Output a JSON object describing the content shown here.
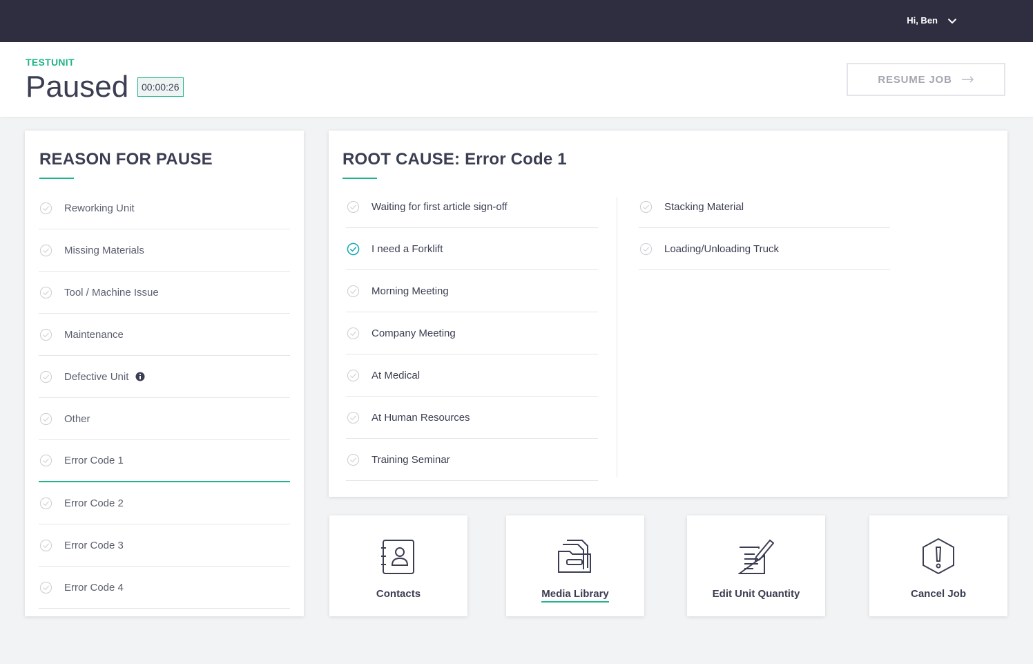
{
  "topbar": {
    "user_greeting": "Hi, Ben"
  },
  "header": {
    "unit_name": "TESTUNIT",
    "status": "Paused",
    "timer": "00:00:26",
    "resume_label": "RESUME JOB"
  },
  "reason_panel": {
    "title": "REASON FOR PAUSE",
    "items": [
      {
        "label": "Reworking Unit"
      },
      {
        "label": "Missing Materials"
      },
      {
        "label": "Tool / Machine Issue"
      },
      {
        "label": "Maintenance"
      },
      {
        "label": "Defective Unit"
      },
      {
        "label": "Other"
      },
      {
        "label": "Error Code 1"
      },
      {
        "label": "Error Code 2"
      },
      {
        "label": "Error Code 3"
      },
      {
        "label": "Error Code 4"
      }
    ],
    "selected": "Error Code 1"
  },
  "root_cause_panel": {
    "title": "ROOT CAUSE: Error Code 1",
    "column1": [
      {
        "label": "Waiting for first article sign-off"
      },
      {
        "label": "I need a Forklift"
      },
      {
        "label": "Morning Meeting"
      },
      {
        "label": "Company Meeting"
      },
      {
        "label": "At Medical"
      },
      {
        "label": "At Human Resources"
      },
      {
        "label": "Training Seminar"
      }
    ],
    "column2": [
      {
        "label": "Stacking Material"
      },
      {
        "label": "Loading/Unloading Truck"
      }
    ],
    "selected": "I need a Forklift"
  },
  "actions": {
    "contacts": "Contacts",
    "media_library": "Media Library",
    "edit_unit_quantity": "Edit Unit Quantity",
    "cancel_job": "Cancel Job"
  },
  "colors": {
    "accent": "#1fb489",
    "topbar": "#2f2e41",
    "selected_check": "#14a8b5"
  },
  "icons": {
    "item_check": "circle-check-icon",
    "info": "info-icon",
    "user_menu": "chevron-down-icon",
    "resume": "arrow-right-icon",
    "contacts": "address-book-icon",
    "media_library": "folder-files-icon",
    "edit_unit_quantity": "document-pencil-icon",
    "cancel_job": "hexagon-exclamation-icon"
  }
}
